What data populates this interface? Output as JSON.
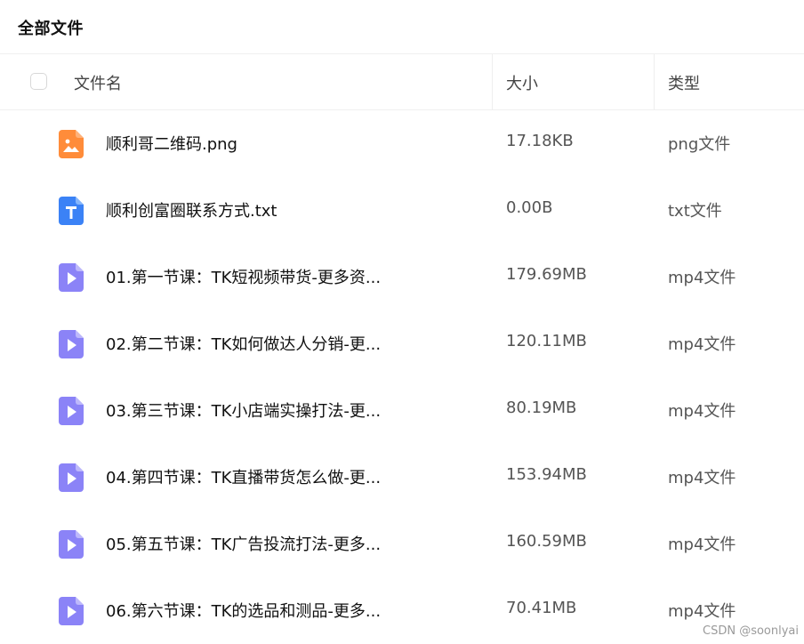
{
  "header": {
    "title": "全部文件"
  },
  "table": {
    "columns": {
      "name": "文件名",
      "size": "大小",
      "type": "类型"
    },
    "rows": [
      {
        "name": "顺利哥二维码.png",
        "size": "17.18KB",
        "type": "png文件",
        "icon": "image-file-icon"
      },
      {
        "name": "顺利创富圈联系方式.txt",
        "size": "0.00B",
        "type": "txt文件",
        "icon": "text-file-icon"
      },
      {
        "name": "01.第一节课：TK短视频带货-更多资...",
        "size": "179.69MB",
        "type": "mp4文件",
        "icon": "video-file-icon"
      },
      {
        "name": "02.第二节课：TK如何做达人分销-更...",
        "size": "120.11MB",
        "type": "mp4文件",
        "icon": "video-file-icon"
      },
      {
        "name": "03.第三节课：TK小店端实操打法-更...",
        "size": "80.19MB",
        "type": "mp4文件",
        "icon": "video-file-icon"
      },
      {
        "name": "04.第四节课：TK直播带货怎么做-更...",
        "size": "153.94MB",
        "type": "mp4文件",
        "icon": "video-file-icon"
      },
      {
        "name": "05.第五节课：TK广告投流打法-更多...",
        "size": "160.59MB",
        "type": "mp4文件",
        "icon": "video-file-icon"
      },
      {
        "name": "06.第六节课：TK的选品和测品-更多...",
        "size": "70.41MB",
        "type": "mp4文件",
        "icon": "video-file-icon"
      }
    ]
  },
  "watermark": "CSDN @soonlyai",
  "colors": {
    "image_icon": "#ff8c3a",
    "text_icon": "#3b82f6",
    "video_icon": "#8b83f7"
  }
}
